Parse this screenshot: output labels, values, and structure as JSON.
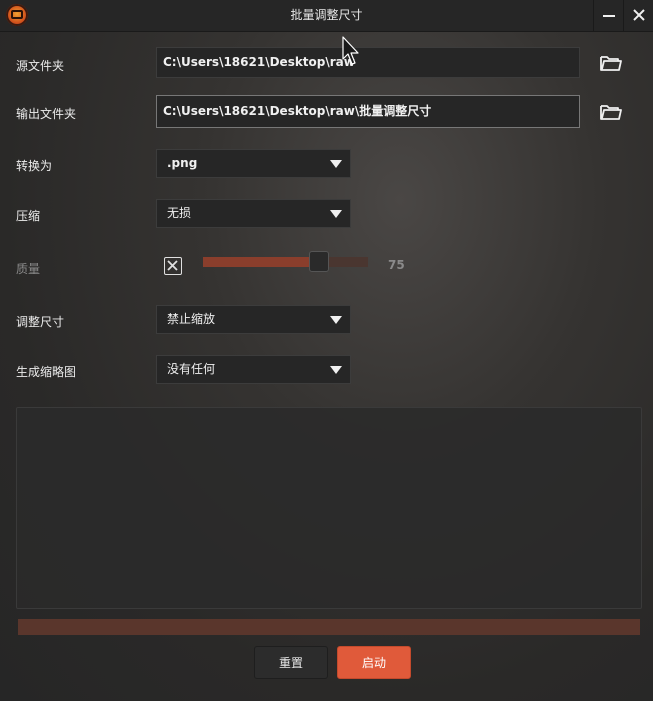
{
  "window": {
    "title": "批量调整尺寸",
    "app_icon": "app-logo-icon",
    "minimize_icon": "minimize-icon",
    "close_icon": "close-icon"
  },
  "form": {
    "source_folder": {
      "label": "源文件夹",
      "value": "C:\\Users\\18621\\Desktop\\raw",
      "browse_icon": "folder-icon"
    },
    "output_folder": {
      "label": "输出文件夹",
      "value": "C:\\Users\\18621\\Desktop\\raw\\批量调整尺寸",
      "browse_icon": "folder-icon"
    },
    "convert_to": {
      "label": "转换为",
      "selected": ".png"
    },
    "compression": {
      "label": "压缩",
      "selected": "无损"
    },
    "quality": {
      "label": "质量",
      "enabled": false,
      "value": "75",
      "slider_fraction": 0.75
    },
    "resize": {
      "label": "调整尺寸",
      "selected": "禁止缩放"
    },
    "thumbnail": {
      "label": "生成缩略图",
      "selected": "没有任何"
    }
  },
  "log": {
    "text": ""
  },
  "progress": {
    "fraction": 0
  },
  "buttons": {
    "reset": "重置",
    "start": "启动"
  },
  "colors": {
    "accent": "#e05a3a",
    "slider_fill": "#8a3e2c",
    "slider_track": "#4a3630",
    "progress_track": "#5a362c"
  }
}
